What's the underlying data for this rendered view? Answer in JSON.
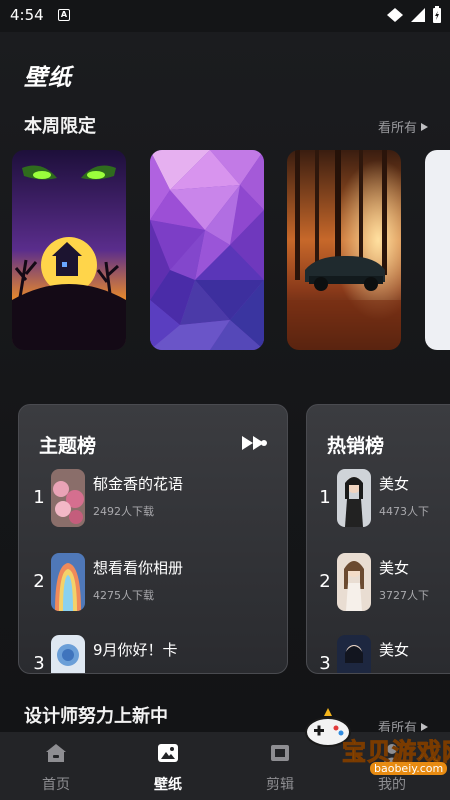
{
  "status_bar": {
    "time": "4:54",
    "notif_letter": "A"
  },
  "page_title": "壁纸",
  "weekly": {
    "title": "本周限定",
    "see_all": "看所有"
  },
  "themes_card": {
    "title": "主题榜",
    "items": [
      {
        "rank": "1",
        "name": "郁金香的花语",
        "downloads": "2492人下载"
      },
      {
        "rank": "2",
        "name": "想看看你相册",
        "downloads": "4275人下载"
      },
      {
        "rank": "3",
        "name": "9月你好！卡",
        "downloads": ""
      }
    ]
  },
  "hot_card": {
    "title": "热销榜",
    "items": [
      {
        "rank": "1",
        "name": "美女",
        "downloads": "4473人下"
      },
      {
        "rank": "2",
        "name": "美女",
        "downloads": "3727人下"
      },
      {
        "rank": "3",
        "name": "美女",
        "downloads": ""
      }
    ]
  },
  "designers": {
    "title": "设计师努力上新中",
    "see_all": "看所有"
  },
  "bottom_nav": [
    {
      "label": "首页",
      "icon": "home-icon"
    },
    {
      "label": "壁纸",
      "icon": "wallpaper-icon"
    },
    {
      "label": "剪辑",
      "icon": "edit-icon"
    },
    {
      "label": "我的",
      "icon": "profile-icon"
    }
  ],
  "watermark": {
    "text": "宝贝游戏网",
    "url": "baobeiy.com"
  },
  "colors": {
    "background": "#111214",
    "card": "#333438",
    "nav": "#232427",
    "accent_watermark": "#f5b51b"
  }
}
